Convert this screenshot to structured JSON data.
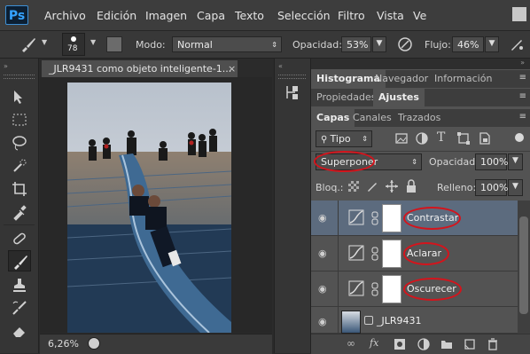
{
  "app": {
    "logo": "Ps"
  },
  "menu": [
    "Archivo",
    "Edición",
    "Imagen",
    "Capa",
    "Texto",
    "Selección",
    "Filtro",
    "Vista",
    "Ve"
  ],
  "options": {
    "brush_size": "78",
    "mode_label": "Modo:",
    "mode_value": "Normal",
    "opacity_label": "Opacidad:",
    "opacity_value": "53%",
    "flow_label": "Flujo:",
    "flow_value": "46%"
  },
  "document": {
    "tab_title": "_JLR9431 como objeto inteligente-1...",
    "zoom": "6,26%"
  },
  "panels": {
    "row1_tabs": [
      "Histograma",
      "Navegador",
      "Información"
    ],
    "row2_tabs": [
      "Propiedades",
      "Ajustes"
    ],
    "row3_tabs": [
      "Capas",
      "Canales",
      "Trazados"
    ],
    "filter_kind": "Tipo",
    "blend_mode": "Superponer",
    "opacity_label": "Opacidad:",
    "opacity_value": "100%",
    "lock_label": "Bloq.:",
    "fill_label": "Relleno:",
    "fill_value": "100%"
  },
  "layers": [
    {
      "name": "Contrastar",
      "selected": true
    },
    {
      "name": "Aclarar",
      "selected": false
    },
    {
      "name": "Oscurecer",
      "selected": false
    },
    {
      "name": "_JLR9431",
      "selected": false
    }
  ],
  "colors": {
    "accent_red": "#d4141c",
    "selected_layer": "#5c6b7e",
    "ps_blue": "#35a3ff"
  }
}
